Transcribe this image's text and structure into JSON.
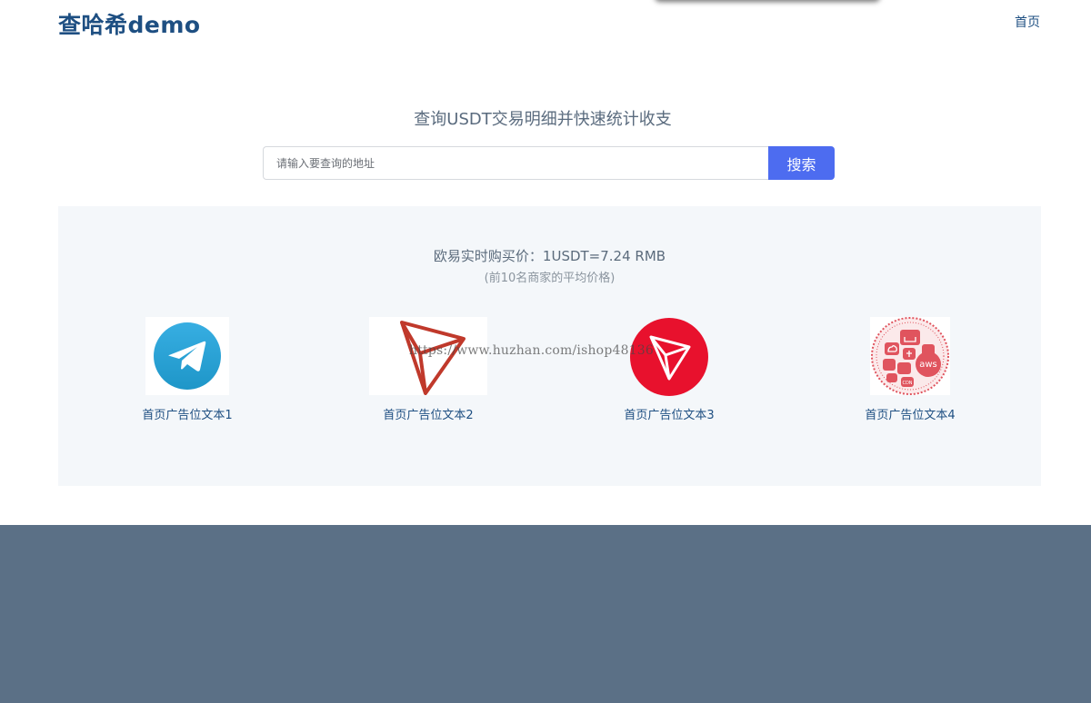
{
  "header": {
    "logo": "查哈希demo",
    "nav_home": "首页"
  },
  "hero": {
    "title": "查询USDT交易明细并快速统计收支",
    "search_placeholder": "请输入要查询的地址",
    "search_button": "搜索"
  },
  "price": {
    "line": "欧易实时购买价：1USDT=7.24 RMB",
    "note": "(前10名商家的平均价格)"
  },
  "ads": [
    {
      "label": "首页广告位文本1",
      "icon": "telegram-icon"
    },
    {
      "label": "首页广告位文本2",
      "icon": "tron-outline-icon"
    },
    {
      "label": "首页广告位文本3",
      "icon": "tron-red-icon"
    },
    {
      "label": "首页广告位文本4",
      "icon": "cloud-aws-icon"
    }
  ],
  "watermark": "https://www.huzhan.com/ishop48136",
  "colors": {
    "brand": "#1e4f82",
    "button": "#4d6cf0",
    "panel_bg": "#f4f7fa",
    "footer_bg": "#5b7086"
  }
}
